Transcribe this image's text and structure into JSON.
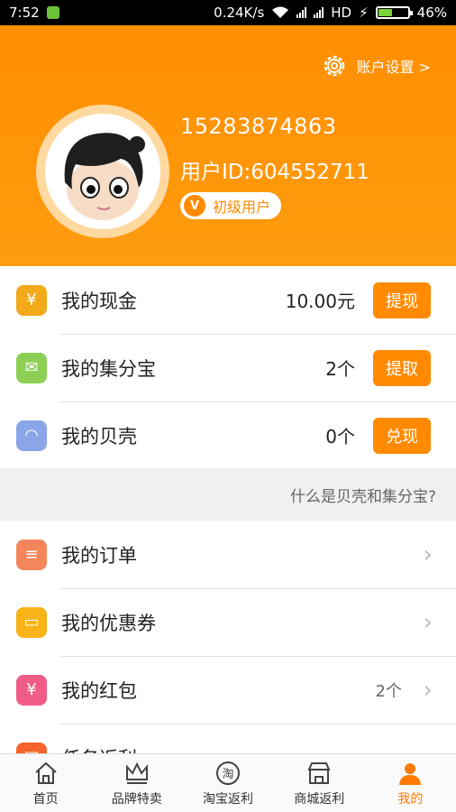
{
  "status": {
    "time": "7:52",
    "speed": "0.24K/s",
    "network": "HD",
    "battery": "46%",
    "battery_level": 0.46
  },
  "header": {
    "settings_label": "账户设置 >",
    "phone": "15283874863",
    "user_id": "用户ID:604552711",
    "level_icon": "V",
    "level_label": "初级用户"
  },
  "wallet": [
    {
      "icon": "yuan-coin-icon",
      "icon_char": "¥",
      "color": "#f2a91a",
      "label": "我的现金",
      "value": "10.00元",
      "button": "提现"
    },
    {
      "icon": "envelope-icon",
      "icon_char": "✉",
      "color": "#8ccf54",
      "label": "我的集分宝",
      "value": "2个",
      "button": "提取"
    },
    {
      "icon": "shell-icon",
      "icon_char": "◠",
      "color": "#8aa6e8",
      "label": "我的贝壳",
      "value": "0个",
      "button": "兑现"
    }
  ],
  "help_link": "什么是贝壳和集分宝?",
  "menu": [
    {
      "icon": "order-icon",
      "icon_char": "≡",
      "color": "#f4865c",
      "label": "我的订单",
      "value": ""
    },
    {
      "icon": "ticket-icon",
      "icon_char": "▭",
      "color": "#f8b317",
      "label": "我的优惠券",
      "value": ""
    },
    {
      "icon": "red-packet-icon",
      "icon_char": "¥",
      "color": "#ef5d86",
      "label": "我的红包",
      "value": "2个"
    },
    {
      "icon": "task-icon",
      "icon_char": "▤",
      "color": "#f4632a",
      "label": "任务返利",
      "value": ""
    }
  ],
  "tabs": [
    {
      "icon": "home-icon",
      "label": "首页"
    },
    {
      "icon": "crown-icon",
      "label": "品牌特卖"
    },
    {
      "icon": "taobao-icon",
      "label": "淘宝返利"
    },
    {
      "icon": "store-icon",
      "label": "商城返利"
    },
    {
      "icon": "person-icon",
      "label": "我的"
    }
  ],
  "colors": {
    "accent": "#ff8a00",
    "header_top": "#ff8e00"
  }
}
